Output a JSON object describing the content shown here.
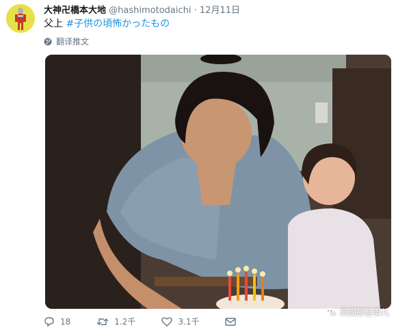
{
  "tweet": {
    "author_name": "大神卍橋本大地",
    "handle": "@hashimotodaichi",
    "separator": "·",
    "date": "12月11日",
    "text_prefix": "父上",
    "hashtag": "#子供の頃怖かったもの",
    "translate_label": "翻译推文"
  },
  "actions": {
    "reply_count": "18",
    "retweet_count": "1.2千",
    "like_count": "3.1千"
  },
  "watermark": {
    "text": "英国那些事儿"
  },
  "icons": {
    "avatar": "ultraman-figure-avatar",
    "translate": "globe-icon",
    "reply": "reply-icon",
    "retweet": "retweet-icon",
    "like": "heart-icon",
    "dm": "mail-icon",
    "watermark": "wechat-logo-icon"
  },
  "colors": {
    "hashtag": "#1b95e0",
    "secondary_text": "#657786",
    "avatar_bg": "#e8e04a"
  }
}
